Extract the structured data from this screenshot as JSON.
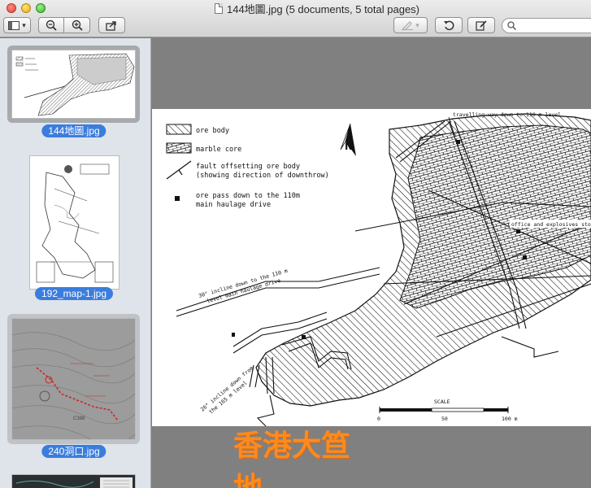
{
  "window": {
    "title": "144地圖.jpg (5 documents, 5 total pages)"
  },
  "toolbar": {
    "sidebar_toggle_icon": "sidebar-icon",
    "dropdown_glyph": "▾",
    "zoom_out_glyph": "−",
    "zoom_in_glyph": "+",
    "share_glyph": "⇪",
    "annotate_glyph": "✎",
    "rotate_glyph": "↺",
    "edit_glyph": "✎",
    "search_placeholder": ""
  },
  "sidebar": {
    "items": [
      {
        "label": "144地圖.jpg",
        "selected": true
      },
      {
        "label": "192_map-1.jpg",
        "selected": false
      },
      {
        "label": "240洞口.jpg",
        "selected": false
      }
    ]
  },
  "document": {
    "legend": {
      "ore_body": "ore body",
      "marble_core": "marble core",
      "fault_line1": "fault offsetting ore body",
      "fault_line2": "(showing direction of downthrow)",
      "ore_pass_line1": "ore pass down to the 110m",
      "ore_pass_line2": "main haulage drive"
    },
    "north_label": "N",
    "annotations": {
      "travelling_way": "travelling-way down to 110 m level",
      "office": "office and explosives store",
      "incline30_line1": "30° incline down to the 110 m",
      "incline30_line2": "level main haulage drive",
      "incline26_line1": "26° incline down from",
      "incline26_line2": "the 165 m level"
    },
    "scale": {
      "title": "SCALE",
      "tick_start": "0",
      "tick_mid": "50",
      "tick_end": "100 m"
    }
  },
  "watermark": "香港大笪地",
  "colors": {
    "selection_blue": "#3b7ddd",
    "watermark_orange": "#ff8a1c"
  }
}
